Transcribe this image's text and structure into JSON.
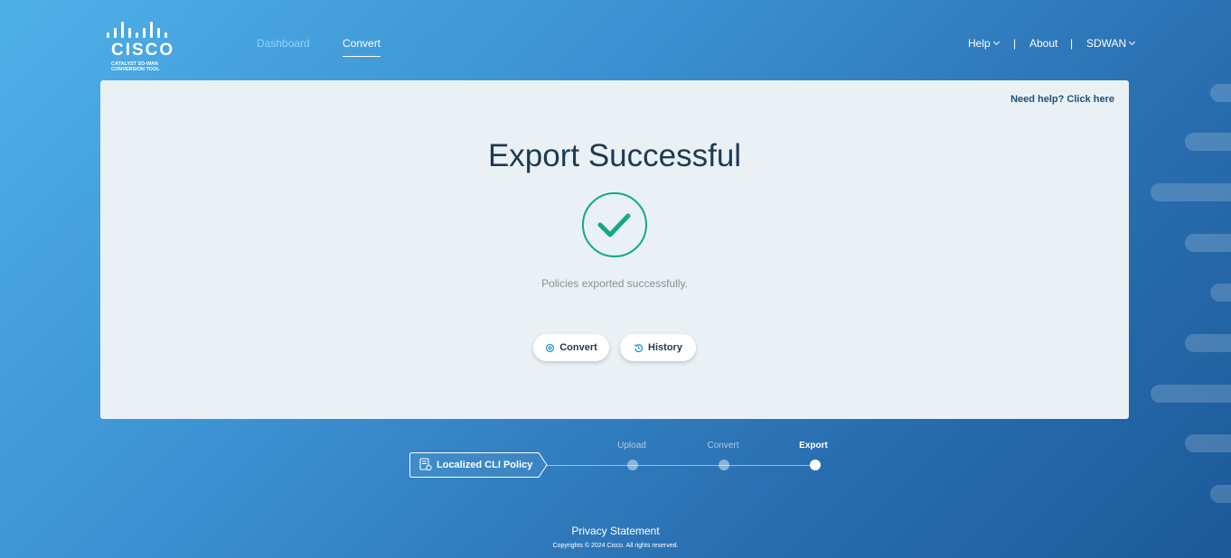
{
  "header": {
    "logo_word": "CISCO",
    "logo_sub_line1": "CATALYST SD-WAN",
    "logo_sub_line2": "CONVERSION TOOL",
    "nav": {
      "dashboard": "Dashboard",
      "convert": "Convert"
    },
    "right": {
      "help": "Help",
      "separator": "|",
      "about": "About",
      "sdwan": "SDWAN"
    }
  },
  "card": {
    "need_help": "Need help? Click here",
    "title": "Export Successful",
    "message": "Policies exported successfully.",
    "buttons": {
      "convert": "Convert",
      "history": "History"
    }
  },
  "stepper": {
    "policy_label": "Localized CLI Policy",
    "steps": [
      {
        "label": "Upload",
        "active": false
      },
      {
        "label": "Convert",
        "active": false
      },
      {
        "label": "Export",
        "active": true
      }
    ]
  },
  "footer": {
    "privacy": "Privacy Statement",
    "copyright": "Copyrights © 2024 Cisco. All rights reserved."
  },
  "colors": {
    "success": "#14a888",
    "title": "#1e3a52",
    "accent_link": "#8fd3ff"
  }
}
